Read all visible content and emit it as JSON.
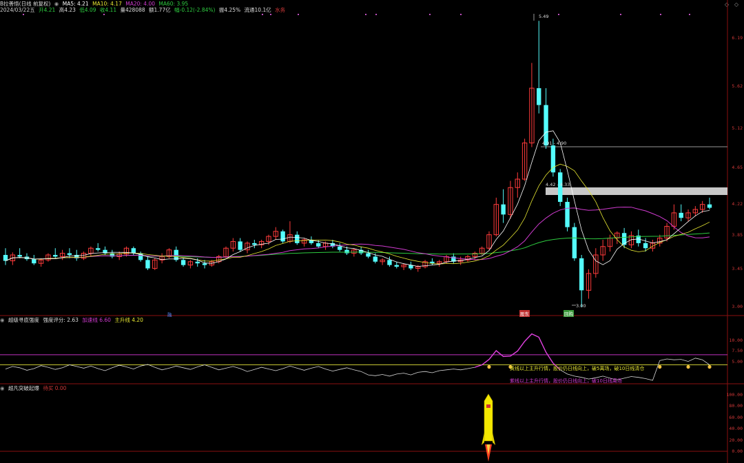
{
  "main_header": {
    "title": "B拉善悟(日线 前复权)",
    "ma5_label": "MA5: 4.21",
    "ma10_label": "MA10: 4.17",
    "ma20_label": "MA20: 4.00",
    "ma60_label": "MA60: 3.95"
  },
  "info_bar": {
    "date": "2024/03/22五",
    "open": "开4.21",
    "high": "高4.23",
    "low": "低4.09",
    "close": "收4.11",
    "volume": "量428088",
    "amount": "额1.77亿",
    "change": "幅-0.12(-2.84%)",
    "amplitude": "振4.25%",
    "float_cap": "流通10.1亿",
    "unit": "水务"
  },
  "price_axis": [
    "6.19",
    "5.62",
    "5.12",
    "4.65",
    "4.22",
    "3.85",
    "3.45",
    "3.00"
  ],
  "price_annotations": {
    "high": "5.49",
    "low": "3.00",
    "level1": "4.91 - 4.90",
    "level2": "4.42 - 4.33"
  },
  "event_markers": [
    "融",
    "股东",
    "回购"
  ],
  "ind1": {
    "title": "超级寻底强度",
    "strength": "强度评分: 2.63",
    "acc_line": "加速线 6.60",
    "main_line": "主升线 4.20",
    "axis": [
      "10.00",
      "7.50",
      "5.00"
    ],
    "note_yellow": "黄线以上主升行情，股价仍日线向上，破5离场，破10日线清仓",
    "note_purple": "紫线以上主升行情，股价仍日线向上，破10日线离场"
  },
  "ind2": {
    "title": "超凡突破起爆",
    "signal": "待买 0.00",
    "axis": [
      "100.00",
      "80.00",
      "60.00",
      "40.00",
      "20.00",
      "0.00"
    ]
  },
  "colors": {
    "up": "#ff3b3b",
    "down": "#54fcfc",
    "ma5": "#ffffff",
    "ma10": "#e6e632",
    "ma20": "#d03bd0",
    "ma60": "#2ecc40",
    "axis_text": "#d03838",
    "panel_line": "#8b1010"
  },
  "chart_data": {
    "type": "candlestick",
    "price_range": [
      2.9,
      6.5
    ],
    "candles_ohlc": [
      [
        3.62,
        3.7,
        3.5,
        3.55
      ],
      [
        3.55,
        3.65,
        3.5,
        3.62
      ],
      [
        3.62,
        3.7,
        3.58,
        3.6
      ],
      [
        3.6,
        3.64,
        3.55,
        3.57
      ],
      [
        3.57,
        3.62,
        3.5,
        3.52
      ],
      [
        3.52,
        3.58,
        3.48,
        3.56
      ],
      [
        3.56,
        3.64,
        3.54,
        3.62
      ],
      [
        3.62,
        3.7,
        3.58,
        3.6
      ],
      [
        3.6,
        3.68,
        3.56,
        3.64
      ],
      [
        3.64,
        3.7,
        3.58,
        3.62
      ],
      [
        3.62,
        3.68,
        3.55,
        3.58
      ],
      [
        3.58,
        3.66,
        3.56,
        3.64
      ],
      [
        3.64,
        3.72,
        3.6,
        3.7
      ],
      [
        3.7,
        3.76,
        3.66,
        3.68
      ],
      [
        3.68,
        3.72,
        3.62,
        3.64
      ],
      [
        3.64,
        3.68,
        3.58,
        3.6
      ],
      [
        3.6,
        3.66,
        3.56,
        3.63
      ],
      [
        3.63,
        3.72,
        3.6,
        3.7
      ],
      [
        3.7,
        3.72,
        3.62,
        3.64
      ],
      [
        3.64,
        3.66,
        3.54,
        3.56
      ],
      [
        3.56,
        3.6,
        3.44,
        3.46
      ],
      [
        3.46,
        3.58,
        3.44,
        3.56
      ],
      [
        3.56,
        3.64,
        3.52,
        3.6
      ],
      [
        3.6,
        3.7,
        3.58,
        3.68
      ],
      [
        3.68,
        3.72,
        3.54,
        3.56
      ],
      [
        3.56,
        3.58,
        3.48,
        3.5
      ],
      [
        3.5,
        3.56,
        3.46,
        3.54
      ],
      [
        3.54,
        3.58,
        3.48,
        3.52
      ],
      [
        3.52,
        3.56,
        3.46,
        3.5
      ],
      [
        3.5,
        3.56,
        3.48,
        3.54
      ],
      [
        3.54,
        3.62,
        3.52,
        3.6
      ],
      [
        3.6,
        3.72,
        3.58,
        3.7
      ],
      [
        3.7,
        3.82,
        3.66,
        3.78
      ],
      [
        3.78,
        3.82,
        3.66,
        3.68
      ],
      [
        3.68,
        3.78,
        3.64,
        3.76
      ],
      [
        3.76,
        3.8,
        3.7,
        3.74
      ],
      [
        3.74,
        3.8,
        3.7,
        3.78
      ],
      [
        3.78,
        3.86,
        3.74,
        3.84
      ],
      [
        3.84,
        3.95,
        3.8,
        3.9
      ],
      [
        3.9,
        3.92,
        3.76,
        3.78
      ],
      [
        3.78,
        4.02,
        3.76,
        3.86
      ],
      [
        3.86,
        3.9,
        3.74,
        3.76
      ],
      [
        3.76,
        3.82,
        3.72,
        3.8
      ],
      [
        3.8,
        3.84,
        3.74,
        3.76
      ],
      [
        3.76,
        3.8,
        3.7,
        3.72
      ],
      [
        3.72,
        3.78,
        3.68,
        3.76
      ],
      [
        3.76,
        3.8,
        3.7,
        3.72
      ],
      [
        3.72,
        3.76,
        3.66,
        3.68
      ],
      [
        3.68,
        3.72,
        3.62,
        3.64
      ],
      [
        3.64,
        3.7,
        3.6,
        3.68
      ],
      [
        3.68,
        3.72,
        3.62,
        3.64
      ],
      [
        3.64,
        3.68,
        3.58,
        3.6
      ],
      [
        3.6,
        3.64,
        3.52,
        3.54
      ],
      [
        3.54,
        3.58,
        3.5,
        3.56
      ],
      [
        3.56,
        3.6,
        3.48,
        3.5
      ],
      [
        3.5,
        3.54,
        3.46,
        3.48
      ],
      [
        3.48,
        3.52,
        3.44,
        3.5
      ],
      [
        3.5,
        3.54,
        3.44,
        3.46
      ],
      [
        3.46,
        3.5,
        3.42,
        3.48
      ],
      [
        3.48,
        3.56,
        3.46,
        3.54
      ],
      [
        3.54,
        3.58,
        3.5,
        3.52
      ],
      [
        3.52,
        3.56,
        3.48,
        3.54
      ],
      [
        3.54,
        3.62,
        3.52,
        3.6
      ],
      [
        3.6,
        3.64,
        3.52,
        3.54
      ],
      [
        3.54,
        3.6,
        3.5,
        3.56
      ],
      [
        3.56,
        3.62,
        3.54,
        3.6
      ],
      [
        3.6,
        3.66,
        3.56,
        3.64
      ],
      [
        3.64,
        3.72,
        3.62,
        3.7
      ],
      [
        3.7,
        3.9,
        3.68,
        3.86
      ],
      [
        3.86,
        4.3,
        3.84,
        4.22
      ],
      [
        4.22,
        4.4,
        4.0,
        4.1
      ],
      [
        4.1,
        4.5,
        4.05,
        4.42
      ],
      [
        4.42,
        4.6,
        4.3,
        4.52
      ],
      [
        4.52,
        5.0,
        4.5,
        4.95
      ],
      [
        4.95,
        5.9,
        4.9,
        5.6
      ],
      [
        5.6,
        6.4,
        5.3,
        5.4
      ],
      [
        5.4,
        5.6,
        4.88,
        4.92
      ],
      [
        4.92,
        5.0,
        4.55,
        4.6
      ],
      [
        4.6,
        4.64,
        4.2,
        4.25
      ],
      [
        4.25,
        4.3,
        3.9,
        3.95
      ],
      [
        3.95,
        4.0,
        3.55,
        3.58
      ],
      [
        3.58,
        3.62,
        3.0,
        3.2
      ],
      [
        3.2,
        3.45,
        3.1,
        3.4
      ],
      [
        3.4,
        3.7,
        3.35,
        3.62
      ],
      [
        3.62,
        3.8,
        3.55,
        3.72
      ],
      [
        3.72,
        3.86,
        3.66,
        3.82
      ],
      [
        3.82,
        3.9,
        3.75,
        3.88
      ],
      [
        3.88,
        3.94,
        3.7,
        3.74
      ],
      [
        3.74,
        3.9,
        3.7,
        3.85
      ],
      [
        3.85,
        3.92,
        3.72,
        3.76
      ],
      [
        3.76,
        3.82,
        3.66,
        3.7
      ],
      [
        3.7,
        3.8,
        3.66,
        3.76
      ],
      [
        3.76,
        3.86,
        3.72,
        3.82
      ],
      [
        3.82,
        4.0,
        3.78,
        3.96
      ],
      [
        3.96,
        4.22,
        3.92,
        4.12
      ],
      [
        4.12,
        4.22,
        4.02,
        4.06
      ],
      [
        4.06,
        4.16,
        4.02,
        4.12
      ],
      [
        4.12,
        4.2,
        4.08,
        4.16
      ],
      [
        4.16,
        4.26,
        4.12,
        4.22
      ],
      [
        4.22,
        4.3,
        4.16,
        4.18
      ]
    ],
    "ind1_line": [
      3.2,
      3.8,
      3.5,
      2.9,
      3.3,
      4.0,
      3.6,
      3.1,
      3.5,
      4.2,
      3.8,
      3.4,
      3.9,
      3.3,
      2.8,
      3.5,
      4.1,
      3.7,
      3.2,
      3.9,
      4.3,
      3.6,
      3.0,
      3.4,
      3.9,
      3.5,
      3.1,
      3.7,
      4.2,
      3.6,
      3.0,
      3.4,
      3.8,
      3.3,
      2.6,
      3.1,
      3.6,
      3.2,
      2.8,
      3.3,
      3.9,
      3.4,
      2.9,
      3.4,
      3.8,
      3.2,
      2.7,
      3.1,
      3.5,
      3.0,
      2.6,
      1.8,
      1.6,
      1.9,
      1.5,
      2.0,
      2.2,
      1.8,
      2.4,
      2.6,
      2.3,
      2.8,
      3.0,
      3.2,
      3.0,
      3.3,
      3.6,
      4.2,
      5.5,
      7.6,
      6.2,
      6.3,
      7.5,
      9.8,
      11.6,
      10.8,
      7.2,
      4.6,
      3.0,
      2.0,
      1.5,
      1.2,
      0.8,
      1.1,
      1.5,
      1.0,
      0.6,
      1.0,
      1.4,
      1.2,
      0.9,
      0.5,
      5.2,
      5.6,
      5.4,
      5.5,
      5.0,
      5.8,
      5.4,
      4.2
    ],
    "ind1_purple_level": 6.6,
    "ind1_yellow_level": 4.2,
    "ind2_signal": 0.0
  }
}
